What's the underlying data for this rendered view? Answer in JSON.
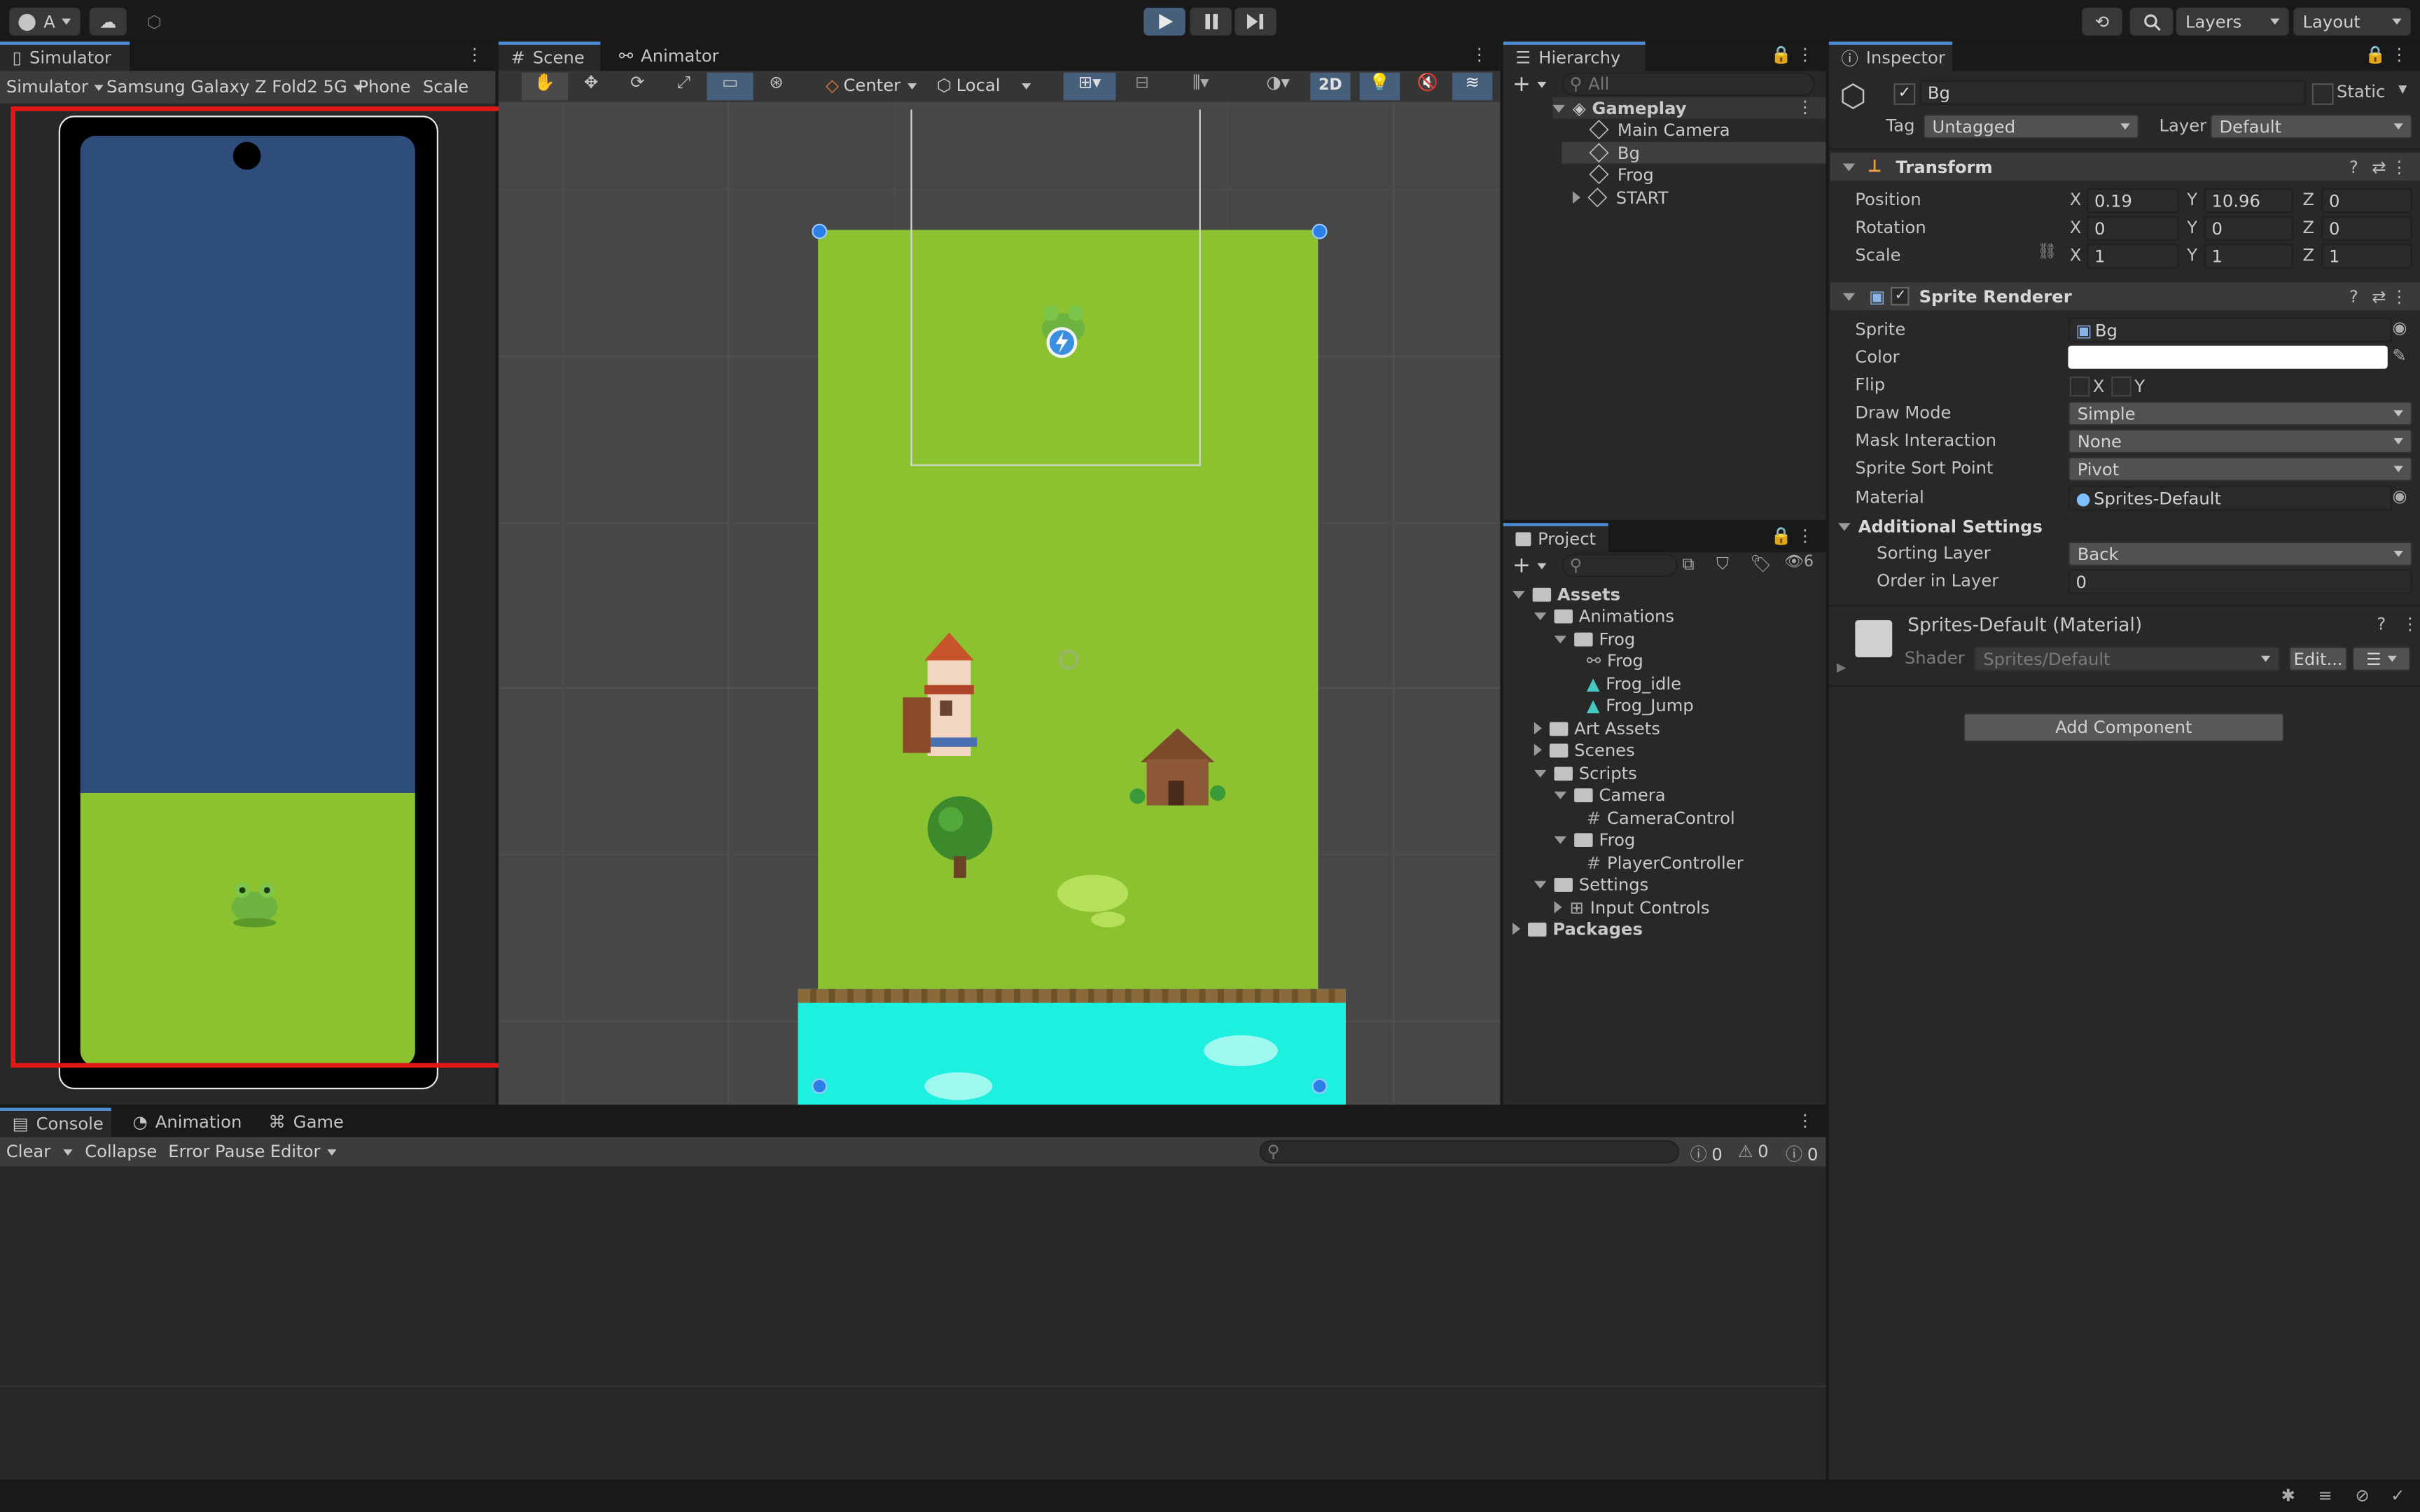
{
  "toolbar": {
    "account_label": "A",
    "layers_label": "Layers",
    "layout_label": "Layout"
  },
  "simulator": {
    "tab_label": "Simulator",
    "mode": "Simulator",
    "device": "Samsung Galaxy Z Fold2 5G",
    "phone_label": "Phone",
    "scale_label": "Scale"
  },
  "scene": {
    "tabs": [
      "Scene",
      "Animator"
    ],
    "pivot": "Center",
    "space": "Local",
    "mode_2d": "2D"
  },
  "hierarchy": {
    "tab_label": "Hierarchy",
    "search_placeholder": "All",
    "scene_name": "Gameplay",
    "items": [
      "Main Camera",
      "Bg",
      "Frog",
      "START"
    ]
  },
  "project": {
    "tab_label": "Project",
    "hidden_count": "6",
    "tree": {
      "assets": "Assets",
      "animations": "Animations",
      "frog_folder": "Frog",
      "frog_anim": "Frog",
      "frog_idle": "Frog_idle",
      "frog_jump": "Frog_Jump",
      "art_assets": "Art Assets",
      "scenes": "Scenes",
      "scripts": "Scripts",
      "camera_folder": "Camera",
      "camera_control": "CameraControl",
      "frog_script_folder": "Frog",
      "player_controller": "PlayerController",
      "settings": "Settings",
      "input_controls": "Input Controls",
      "packages": "Packages"
    }
  },
  "inspector": {
    "tab_label": "Inspector",
    "object_name": "Bg",
    "static_label": "Static",
    "tag_label": "Tag",
    "tag_value": "Untagged",
    "layer_label": "Layer",
    "layer_value": "Default",
    "transform": {
      "title": "Transform",
      "position_label": "Position",
      "rotation_label": "Rotation",
      "scale_label": "Scale",
      "axis_x": "X",
      "axis_y": "Y",
      "axis_z": "Z",
      "position": [
        "0.19",
        "10.96",
        "0"
      ],
      "rotation": [
        "0",
        "0",
        "0"
      ],
      "scale": [
        "1",
        "1",
        "1"
      ]
    },
    "sprite_renderer": {
      "title": "Sprite Renderer",
      "sprite_label": "Sprite",
      "sprite_value": "Bg",
      "color_label": "Color",
      "color_value": "#ffffff",
      "flip_label": "Flip",
      "flip_x": "X",
      "flip_y": "Y",
      "draw_mode_label": "Draw Mode",
      "draw_mode_value": "Simple",
      "mask_label": "Mask Interaction",
      "mask_value": "None",
      "sort_point_label": "Sprite Sort Point",
      "sort_point_value": "Pivot",
      "material_label": "Material",
      "material_value": "Sprites-Default",
      "additional_label": "Additional Settings",
      "sorting_layer_label": "Sorting Layer",
      "sorting_layer_value": "Back",
      "order_label": "Order in Layer",
      "order_value": "0"
    },
    "material": {
      "title": "Sprites-Default (Material)",
      "shader_label": "Shader",
      "shader_value": "Sprites/Default",
      "edit_label": "Edit..."
    },
    "add_component": "Add Component"
  },
  "console": {
    "tabs": [
      "Console",
      "Animation",
      "Game"
    ],
    "clear": "Clear",
    "collapse": "Collapse",
    "error_pause": "Error Pause",
    "editor": "Editor",
    "log_count": "0",
    "warn_count": "0",
    "error_count": "0"
  },
  "colors": {
    "accent": "#4d8dd6",
    "selection_box": "#e01818",
    "grass": "#8cc230",
    "sky": "#2f4d7b",
    "water": "#1ef0e0"
  }
}
